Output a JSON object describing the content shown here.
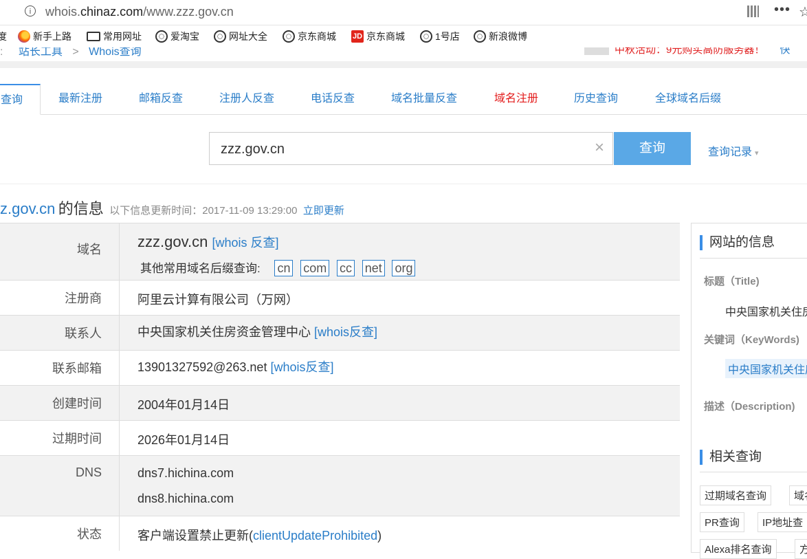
{
  "browser": {
    "url_prefix": "whois.",
    "url_domain": "chinaz.com",
    "url_path": "/www.zzz.gov.cn",
    "menu_dots": "•••",
    "star": "☆"
  },
  "bookmarks": [
    {
      "label": "度",
      "icon": "none"
    },
    {
      "label": "新手上路",
      "icon": "firefox-icon"
    },
    {
      "label": "常用网址",
      "icon": "folder-icon"
    },
    {
      "label": "爱淘宝",
      "icon": "globe-icon"
    },
    {
      "label": "网址大全",
      "icon": "globe-icon"
    },
    {
      "label": "京东商城",
      "icon": "globe-icon"
    },
    {
      "label": "京东商城",
      "icon": "jd-icon"
    },
    {
      "label": "1号店",
      "icon": "globe-icon"
    },
    {
      "label": "新浪微博",
      "icon": "globe-icon"
    }
  ],
  "jd_mark": "JD",
  "breadcrumb": {
    "sep1": ":",
    "item1": "站长工具",
    "sep2": ">",
    "item2": "Whois查询"
  },
  "promo": {
    "text": "中秋活动：9元购买高防服务器！",
    "extra": "快"
  },
  "tabs": [
    {
      "label": "查询"
    },
    {
      "label": "最新注册"
    },
    {
      "label": "邮箱反查"
    },
    {
      "label": "注册人反查"
    },
    {
      "label": "电话反查"
    },
    {
      "label": "域名批量反查"
    },
    {
      "label": "域名注册"
    },
    {
      "label": "历史查询"
    },
    {
      "label": "全球域名后缀"
    }
  ],
  "search": {
    "value": "zzz.gov.cn",
    "clear": "×",
    "button": "查询",
    "history": "查询记录",
    "history_caret": "▾"
  },
  "heading": {
    "domain": "z.gov.cn",
    "label": "的信息",
    "update_text": "以下信息更新时间：2017-11-09 13:29:00",
    "update_link": "立即更新"
  },
  "whois": {
    "domain": {
      "key": "域名",
      "value": "zzz.gov.cn",
      "link": "[whois 反查]",
      "suffix_label": "其他常用域名后缀查询:",
      "suffixes": [
        "cn",
        "com",
        "cc",
        "net",
        "org"
      ]
    },
    "registrar": {
      "key": "注册商",
      "value": "阿里云计算有限公司（万网）"
    },
    "contact": {
      "key": "联系人",
      "value": "中央国家机关住房资金管理中心",
      "link": "[whois反查]"
    },
    "email": {
      "key": "联系邮箱",
      "value": "13901327592@263.net",
      "link": "[whois反查]"
    },
    "created": {
      "key": "创建时间",
      "value": "2004年01月14日"
    },
    "expires": {
      "key": "过期时间",
      "value": "2026年01月14日"
    },
    "dns": {
      "key": "DNS",
      "values": [
        "dns7.hichina.com",
        "dns8.hichina.com"
      ]
    },
    "status": {
      "key": "状态",
      "value_prefix": "客户端设置禁止更新(",
      "value_link": "clientUpdateProhibited",
      "value_suffix": ")"
    }
  },
  "sidebar": {
    "site_info_title": "网站的信息",
    "title_label": "标题（Title)",
    "title_value": "中央国家机关住房",
    "keywords_label": "关键词（KeyWords)",
    "keywords_value": "中央国家机关住房",
    "desc_label": "描述（Description)",
    "related_title": "相关查询",
    "related": [
      "过期域名查询",
      "域名",
      "PR查询",
      "IP地址查",
      "Alexa排名查询",
      "方"
    ]
  }
}
